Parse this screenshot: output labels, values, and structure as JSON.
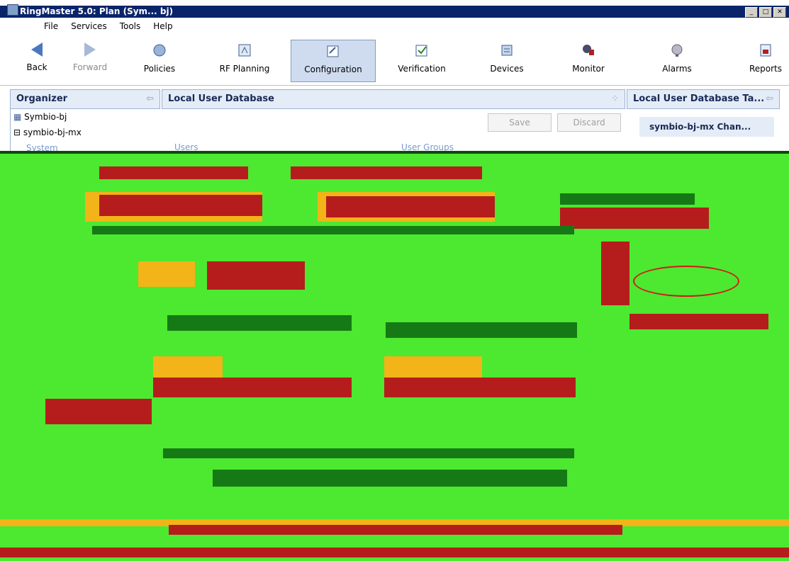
{
  "window": {
    "title": "RingMaster 5.0: Plan (Sym... bj)",
    "buttons": [
      "_",
      "□",
      "✕"
    ]
  },
  "menu": {
    "items": [
      "File",
      "Services",
      "Tools",
      "Help"
    ]
  },
  "toolbar": {
    "back": "Back",
    "forward": "Forward",
    "policies": "Policies",
    "rf_planning": "RF Planning",
    "configuration": "Configuration",
    "verification": "Verification",
    "devices": "Devices",
    "monitor": "Monitor",
    "alarms": "Alarms",
    "reports": "Reports",
    "active": "Configuration"
  },
  "organizer": {
    "title": "Organizer",
    "items": [
      "Symbio-bj",
      "symbio-bj-mx",
      "System"
    ]
  },
  "main": {
    "title": "Local User Database",
    "save": "Save",
    "discard": "Discard",
    "col_users": "Users",
    "col_user_groups": "User Groups"
  },
  "right_panel": {
    "title": "Local User Database Ta...",
    "change": "symbio-bj-mx Chan..."
  },
  "colors": {
    "title_bar": "#0a246a",
    "accent": "#cfdcf0",
    "corrupted_green": "#4de830",
    "corrupted_red": "#b51d1d",
    "corrupted_orange": "#f2b418",
    "highlight_oval": "#d21a1a"
  }
}
